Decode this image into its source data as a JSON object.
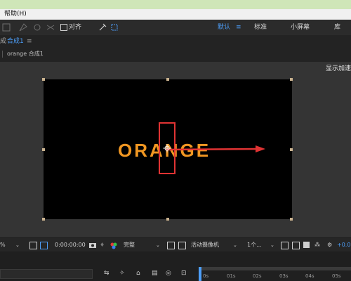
{
  "menubar": {
    "help": "帮助(H)"
  },
  "toolbar": {
    "snap_label": "对齐",
    "workspaces": [
      {
        "label": "默认",
        "active": true
      },
      {
        "label": "标准",
        "active": false
      },
      {
        "label": "小屏幕",
        "active": false
      },
      {
        "label": "库",
        "active": false
      }
    ]
  },
  "panel": {
    "tab_prefix": "成",
    "tab_label": "合成1",
    "breadcrumb": "orange 合成1"
  },
  "viewer": {
    "gpu_notice": "显示加速",
    "text": "ORANGE"
  },
  "bottombar": {
    "zoom": "%",
    "timecode": "0:00:00:00",
    "resolution": "完整",
    "camera": "活动摄像机",
    "views": "1个...",
    "exposure": "+0.0"
  },
  "timeline": {
    "ruler_labels": [
      "0s",
      "01s",
      "02s",
      "03s",
      "04s",
      "05s"
    ]
  },
  "colors": {
    "accent": "#4d9ef8",
    "text_orange": "#f19722",
    "annotation_red": "#e03333",
    "handle": "#c9b28f"
  }
}
